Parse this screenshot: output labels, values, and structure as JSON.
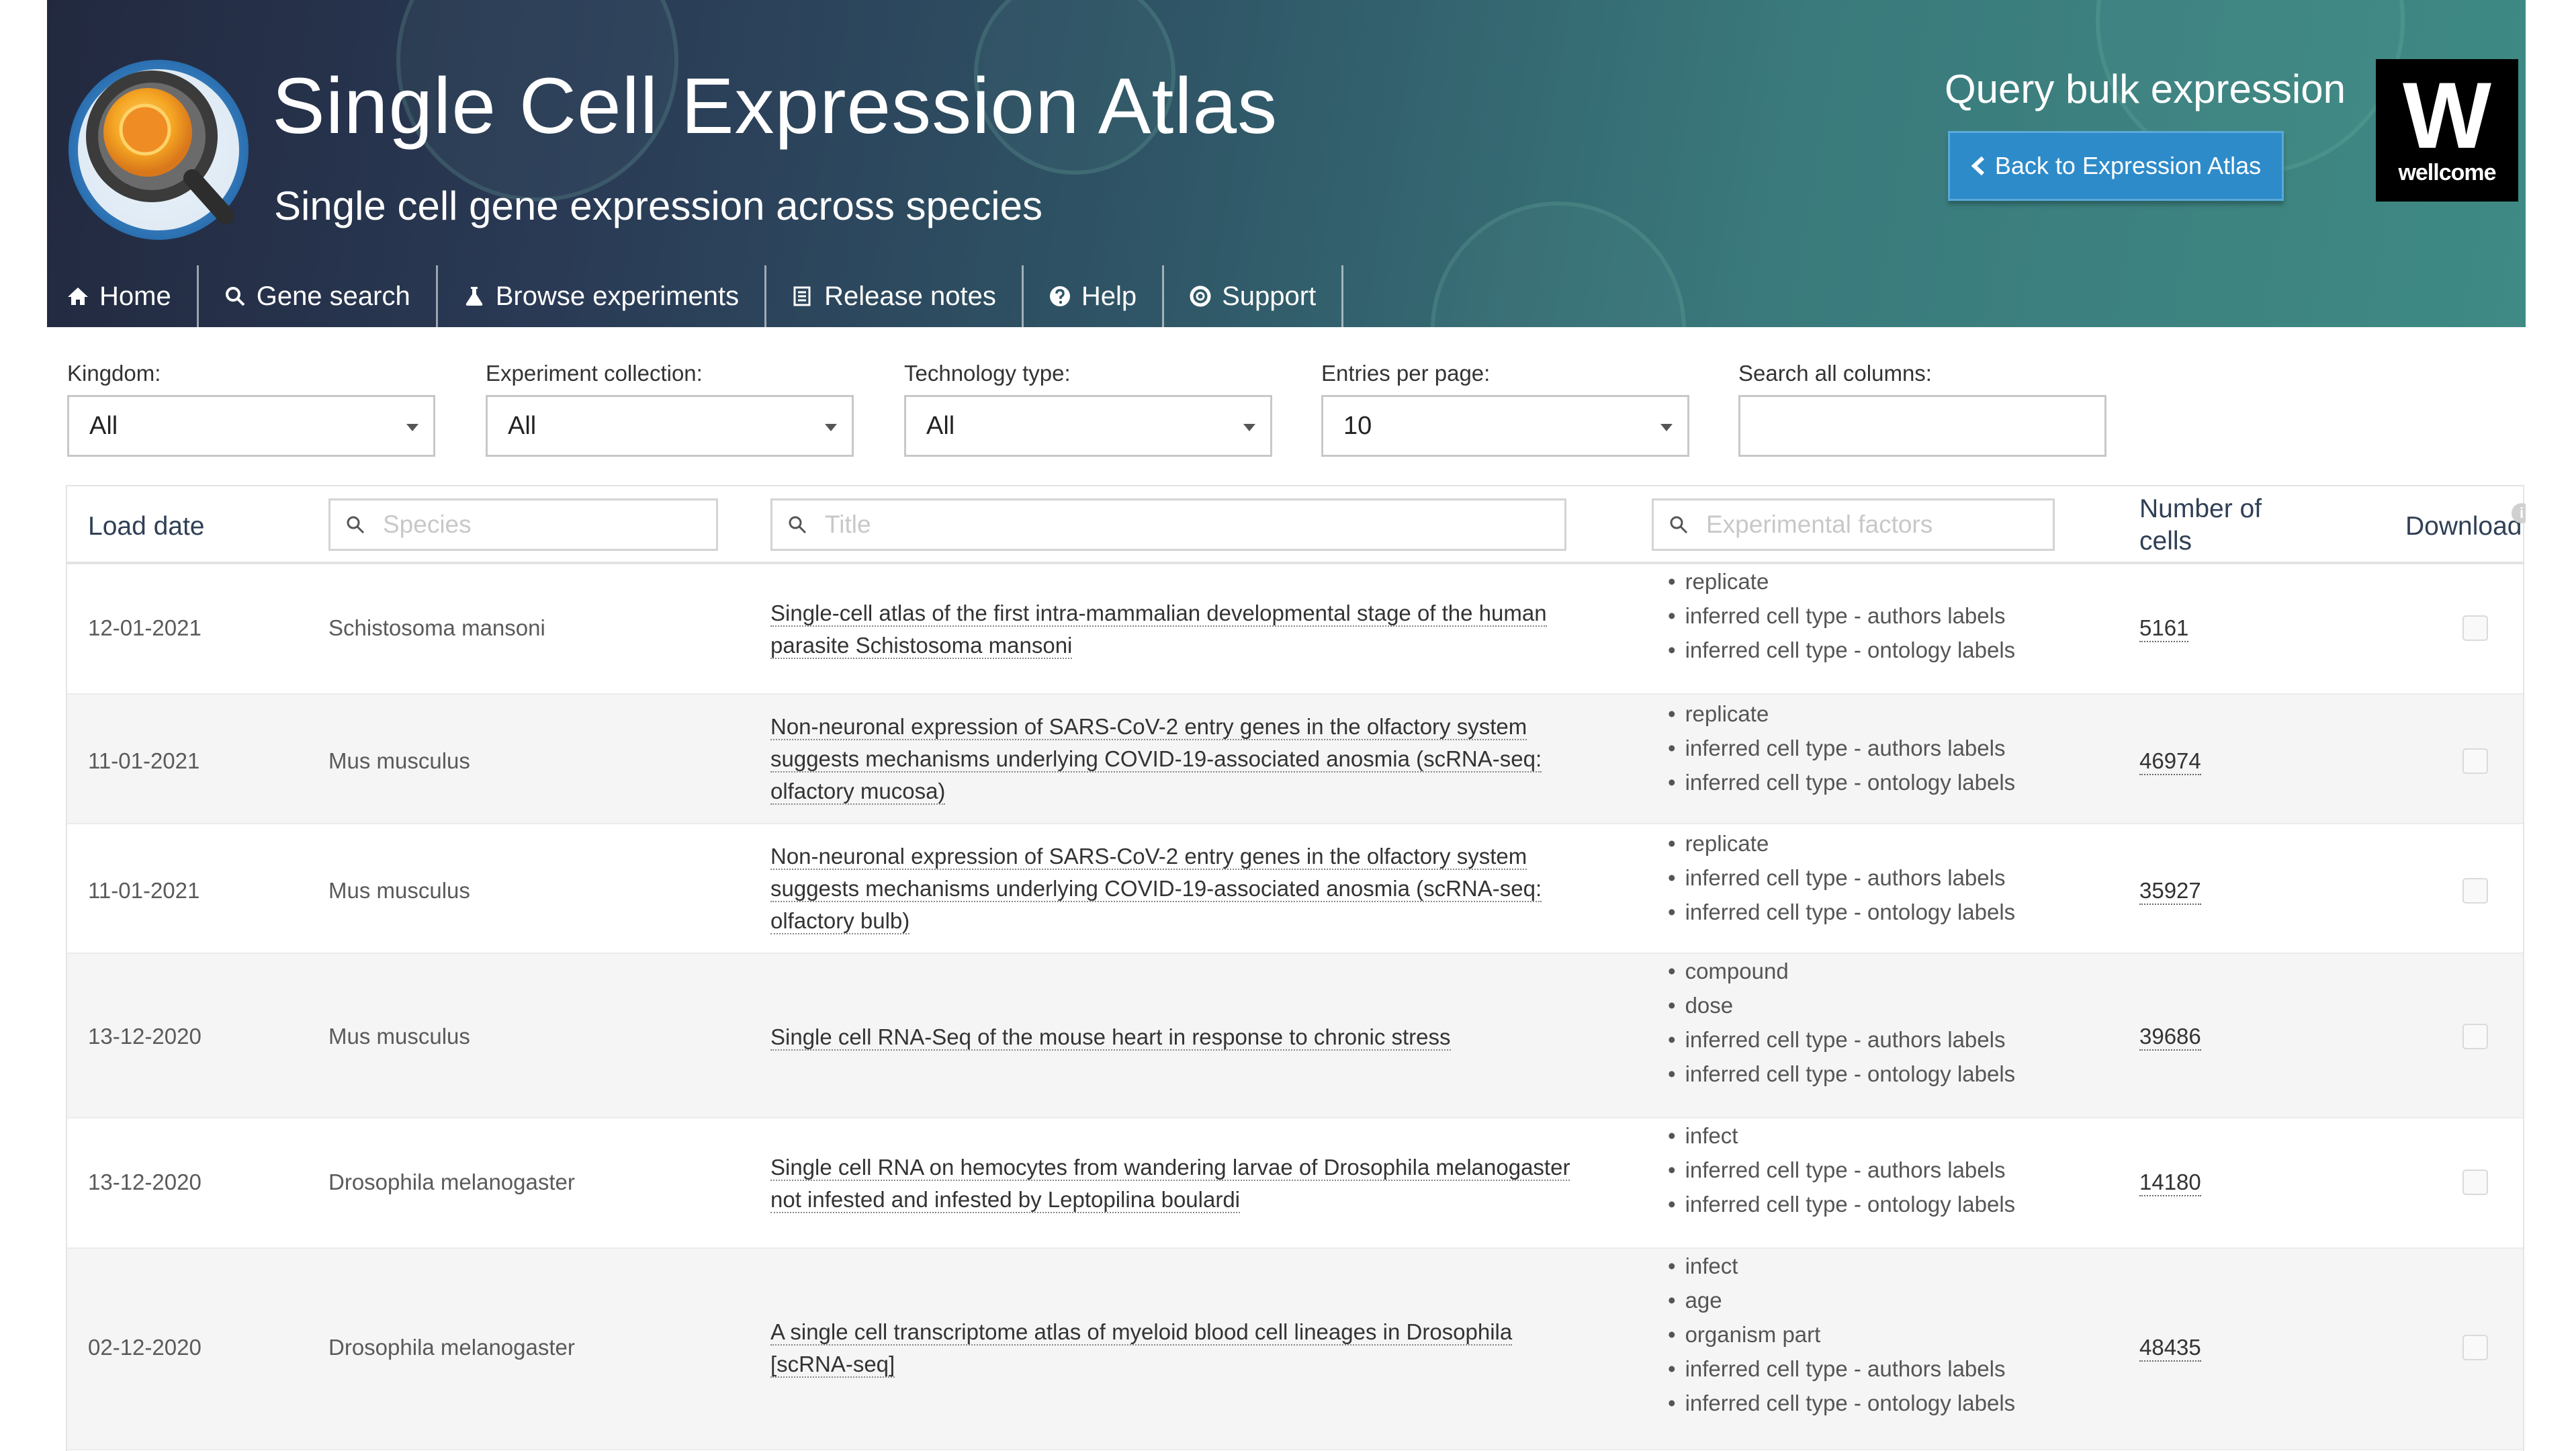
{
  "header": {
    "title": "Single Cell Expression Atlas",
    "subtitle": "Single cell gene expression across species",
    "query_title": "Query bulk expression",
    "back_button": "Back to Expression Atlas",
    "partner_logo_text": "wellcome",
    "partner_logo_letter": "W"
  },
  "nav": [
    {
      "label": "Home",
      "icon": "home-icon"
    },
    {
      "label": "Gene search",
      "icon": "search-icon"
    },
    {
      "label": "Browse experiments",
      "icon": "flask-icon"
    },
    {
      "label": "Release notes",
      "icon": "document-icon"
    },
    {
      "label": "Help",
      "icon": "question-circle-icon"
    },
    {
      "label": "Support",
      "icon": "lifebuoy-icon"
    }
  ],
  "filters": {
    "kingdom": {
      "label": "Kingdom:",
      "value": "All"
    },
    "collection": {
      "label": "Experiment collection:",
      "value": "All"
    },
    "technology": {
      "label": "Technology type:",
      "value": "All"
    },
    "entries": {
      "label": "Entries per page:",
      "value": "10"
    },
    "search_all": {
      "label": "Search all columns:",
      "value": ""
    }
  },
  "table": {
    "headers": {
      "load_date": "Load date",
      "species_placeholder": "Species",
      "title_placeholder": "Title",
      "factors_placeholder": "Experimental factors",
      "cells_line1": "Number of",
      "cells_line2": "cells",
      "download": "Download"
    },
    "rows": [
      {
        "date": "12-01-2021",
        "species": "Schistosoma mansoni",
        "title": "Single-cell atlas of the first intra-mammalian developmental stage of the human parasite Schistosoma mansoni",
        "factors": [
          "replicate",
          "inferred cell type - authors labels",
          "inferred cell type - ontology labels"
        ],
        "cells": "5161"
      },
      {
        "date": "11-01-2021",
        "species": "Mus musculus",
        "title": "Non-neuronal expression of SARS-CoV-2 entry genes in the olfactory system suggests mechanisms underlying COVID-19-associated anosmia (scRNA-seq: olfactory mucosa)",
        "factors": [
          "replicate",
          "inferred cell type - authors labels",
          "inferred cell type - ontology labels"
        ],
        "cells": "46974"
      },
      {
        "date": "11-01-2021",
        "species": "Mus musculus",
        "title": "Non-neuronal expression of SARS-CoV-2 entry genes in the olfactory system suggests mechanisms underlying COVID-19-associated anosmia (scRNA-seq: olfactory bulb)",
        "factors": [
          "replicate",
          "inferred cell type - authors labels",
          "inferred cell type - ontology labels"
        ],
        "cells": "35927"
      },
      {
        "date": "13-12-2020",
        "species": "Mus musculus",
        "title": "Single cell RNA-Seq of the mouse heart in response to chronic stress",
        "factors": [
          "compound",
          "dose",
          "inferred cell type - authors labels",
          "inferred cell type - ontology labels"
        ],
        "cells": "39686"
      },
      {
        "date": "13-12-2020",
        "species": "Drosophila melanogaster",
        "title": "Single cell RNA on hemocytes from wandering larvae of Drosophila melanogaster not infested and infested by Leptopilina boulardi",
        "factors": [
          "infect",
          "inferred cell type - authors labels",
          "inferred cell type - ontology labels"
        ],
        "cells": "14180"
      },
      {
        "date": "02-12-2020",
        "species": "Drosophila melanogaster",
        "title": "A single cell transcriptome atlas of myeloid blood cell lineages in Drosophila [scRNA-seq]",
        "factors": [
          "infect",
          "age",
          "organism part",
          "inferred cell type - authors labels",
          "inferred cell type - ontology labels"
        ],
        "cells": "48435"
      }
    ]
  },
  "colors": {
    "header_dark": "#22293f",
    "header_teal": "#3f8a84",
    "button_blue": "#2e8bc9"
  }
}
